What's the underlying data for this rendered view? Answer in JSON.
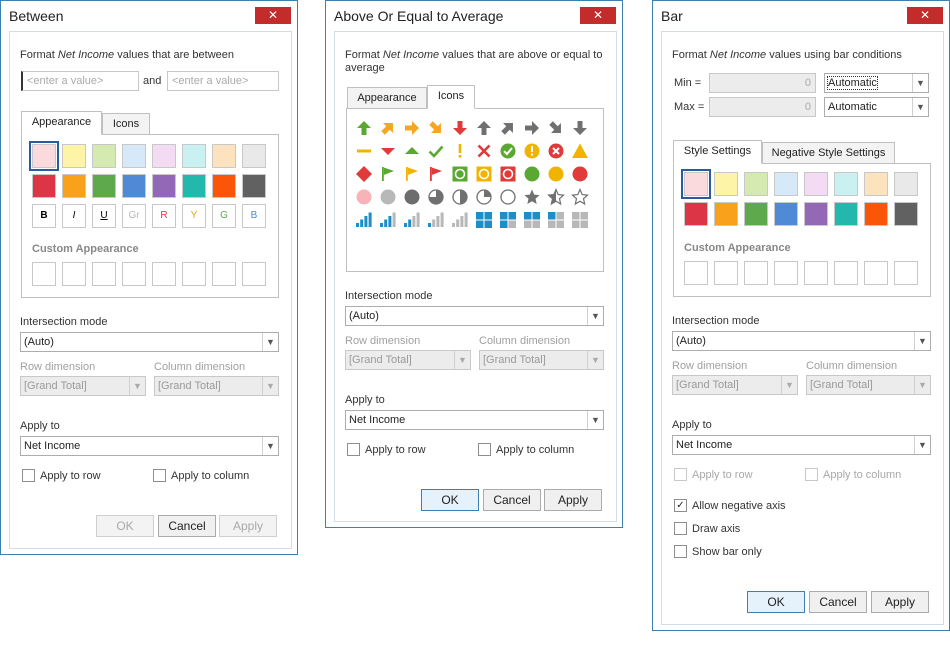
{
  "between": {
    "title": "Between",
    "close": "✕",
    "desc_prefix": "Format ",
    "desc_field": "Net Income",
    "desc_suffix": " values that are between",
    "input1_placeholder": "<enter a value>",
    "and_label": "and",
    "input2_placeholder": "<enter a value>",
    "tabs": [
      "Appearance",
      "Icons"
    ],
    "colors_row1": [
      "#fadadd",
      "#fdf4a8",
      "#d5eab1",
      "#d7e8f9",
      "#f3dcf3",
      "#c9f1f1",
      "#fde2be",
      "#e9e9e9"
    ],
    "colors_row2": [
      "#dc3545",
      "#f9a11b",
      "#5ea94c",
      "#5089d6",
      "#9368b7",
      "#24b7ab",
      "#fb5607",
      "#616161"
    ],
    "format_cells": [
      {
        "text": "B",
        "color": "#000000"
      },
      {
        "text": "I",
        "color": "#000000"
      },
      {
        "text": "U",
        "color": "#000000"
      },
      {
        "text": "Gr",
        "color": "#b7b7b7"
      },
      {
        "text": "R",
        "color": "#dc3545"
      },
      {
        "text": "Y",
        "color": "#e6a817"
      },
      {
        "text": "G",
        "color": "#5ea94c"
      },
      {
        "text": "B",
        "color": "#5089d6"
      }
    ],
    "custom_label": "Custom Appearance",
    "intersection_label": "Intersection mode",
    "intersection_value": "(Auto)",
    "row_dim_label": "Row dimension",
    "row_dim_value": "[Grand Total]",
    "col_dim_label": "Column dimension",
    "col_dim_value": "[Grand Total]",
    "apply_to_label": "Apply to",
    "apply_to_value": "Net Income",
    "apply_row": "Apply to row",
    "apply_col": "Apply to column",
    "ok": "OK",
    "cancel": "Cancel",
    "apply": "Apply"
  },
  "average": {
    "title": "Above Or Equal to Average",
    "close": "✕",
    "desc_prefix": "Format ",
    "desc_field": "Net Income",
    "desc_suffix": " values that are above or equal to",
    "desc_line2": "average",
    "tabs": [
      "Appearance",
      "Icons"
    ],
    "intersection_label": "Intersection mode",
    "intersection_value": "(Auto)",
    "row_dim_label": "Row dimension",
    "row_dim_value": "[Grand Total]",
    "col_dim_label": "Column dimension",
    "col_dim_value": "[Grand Total]",
    "apply_to_label": "Apply to",
    "apply_to_value": "Net Income",
    "apply_row": "Apply to row",
    "apply_col": "Apply to column",
    "ok": "OK",
    "cancel": "Cancel",
    "apply": "Apply",
    "icons": [
      [
        "arrow-up-green-icon",
        "arrow-up-right-orange-icon",
        "arrow-right-orange-icon",
        "arrow-down-right-orange-icon",
        "arrow-down-red-icon",
        "arrow-up-gray-icon",
        "arrow-up-right-gray-icon",
        "arrow-right-gray-icon",
        "arrow-down-right-gray-icon",
        "arrow-down-gray-icon"
      ],
      [
        "dash-yellow-icon",
        "triangle-down-red-icon",
        "triangle-up-green-icon",
        "check-green-icon",
        "exclamation-yellow-icon",
        "cross-red-icon",
        "check-circle-green-icon",
        "exclamation-circle-yellow-icon",
        "cross-circle-red-icon",
        "warning-triangle-yellow-icon"
      ],
      [
        "diamond-red-icon",
        "flag-green-icon",
        "flag-yellow-icon",
        "flag-red-icon",
        "square-circle-green-icon",
        "square-circle-yellow-icon",
        "square-circle-red-icon",
        "circle-green-icon",
        "circle-yellow-icon",
        "circle-red-icon"
      ],
      [
        "circle-pink-icon",
        "circle-gray-icon",
        "circle-dark-icon",
        "pie-three-quarter-icon",
        "pie-half-icon",
        "pie-quarter-icon",
        "circle-empty-icon",
        "star-full-icon",
        "star-half-icon",
        "star-empty-icon"
      ],
      [
        "signal-4-icon",
        "signal-3-icon",
        "signal-2-icon",
        "signal-1-icon",
        "signal-0-icon",
        "boxes-4-icon",
        "boxes-3-icon",
        "boxes-2-icon",
        "boxes-1-icon",
        "boxes-0-icon"
      ]
    ]
  },
  "bar": {
    "title": "Bar",
    "close": "✕",
    "desc_prefix": "Format ",
    "desc_field": "Net Income",
    "desc_suffix": " values using bar conditions",
    "min_label": "Min =",
    "min_value": "0",
    "min_mode": "Automatic",
    "max_label": "Max =",
    "max_value": "0",
    "max_mode": "Automatic",
    "tabs": [
      "Style Settings",
      "Negative Style Settings"
    ],
    "colors_row1": [
      "#fadadd",
      "#fdf4a8",
      "#d5eab1",
      "#d7e8f9",
      "#f3dcf3",
      "#c9f1f1",
      "#fde2be",
      "#e9e9e9"
    ],
    "colors_row2": [
      "#dc3545",
      "#f9a11b",
      "#5ea94c",
      "#5089d6",
      "#9368b7",
      "#24b7ab",
      "#fb5607",
      "#616161"
    ],
    "custom_label": "Custom Appearance",
    "intersection_label": "Intersection mode",
    "intersection_value": "(Auto)",
    "row_dim_label": "Row dimension",
    "row_dim_value": "[Grand Total]",
    "col_dim_label": "Column dimension",
    "col_dim_value": "[Grand Total]",
    "apply_to_label": "Apply to",
    "apply_to_value": "Net Income",
    "apply_row": "Apply to row",
    "apply_col": "Apply to column",
    "allow_negative": "Allow negative axis",
    "draw_axis": "Draw axis",
    "show_bar_only": "Show bar only",
    "ok": "OK",
    "cancel": "Cancel",
    "apply": "Apply"
  }
}
